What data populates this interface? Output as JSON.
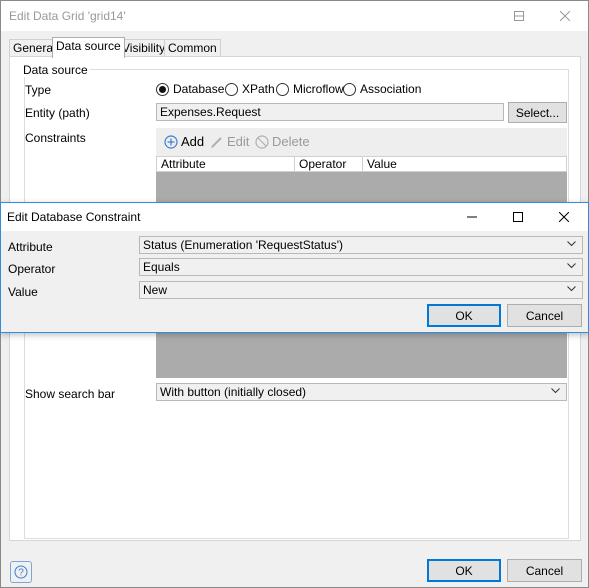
{
  "window": {
    "title": "Edit Data Grid 'grid14'"
  },
  "tabs": [
    {
      "label": "General"
    },
    {
      "label": "Data source"
    },
    {
      "label": "Visibility"
    },
    {
      "label": "Common"
    }
  ],
  "data_source": {
    "group_label": "Data source",
    "type_label": "Type",
    "type_options": [
      {
        "label": "Database",
        "selected": true
      },
      {
        "label": "XPath",
        "selected": false
      },
      {
        "label": "Microflow",
        "selected": false
      },
      {
        "label": "Association",
        "selected": false
      }
    ],
    "entity_label": "Entity (path)",
    "entity_value": "Expenses.Request",
    "select_button": "Select...",
    "constraints_label": "Constraints",
    "toolbar": {
      "add": "Add",
      "edit": "Edit",
      "delete": "Delete"
    },
    "grid_columns": [
      "Attribute",
      "Operator",
      "Value"
    ],
    "search_bar_label": "Show search bar",
    "search_bar_value": "With button (initially closed)"
  },
  "footer": {
    "ok": "OK",
    "cancel": "Cancel"
  },
  "dialog": {
    "title": "Edit Database Constraint",
    "attribute_label": "Attribute",
    "attribute_value": "Status (Enumeration 'RequestStatus')",
    "operator_label": "Operator",
    "operator_value": "Equals",
    "value_label": "Value",
    "value_value": "New",
    "ok": "OK",
    "cancel": "Cancel"
  },
  "colors": {
    "accent": "#0078d7",
    "grid_body": "#ababab"
  }
}
